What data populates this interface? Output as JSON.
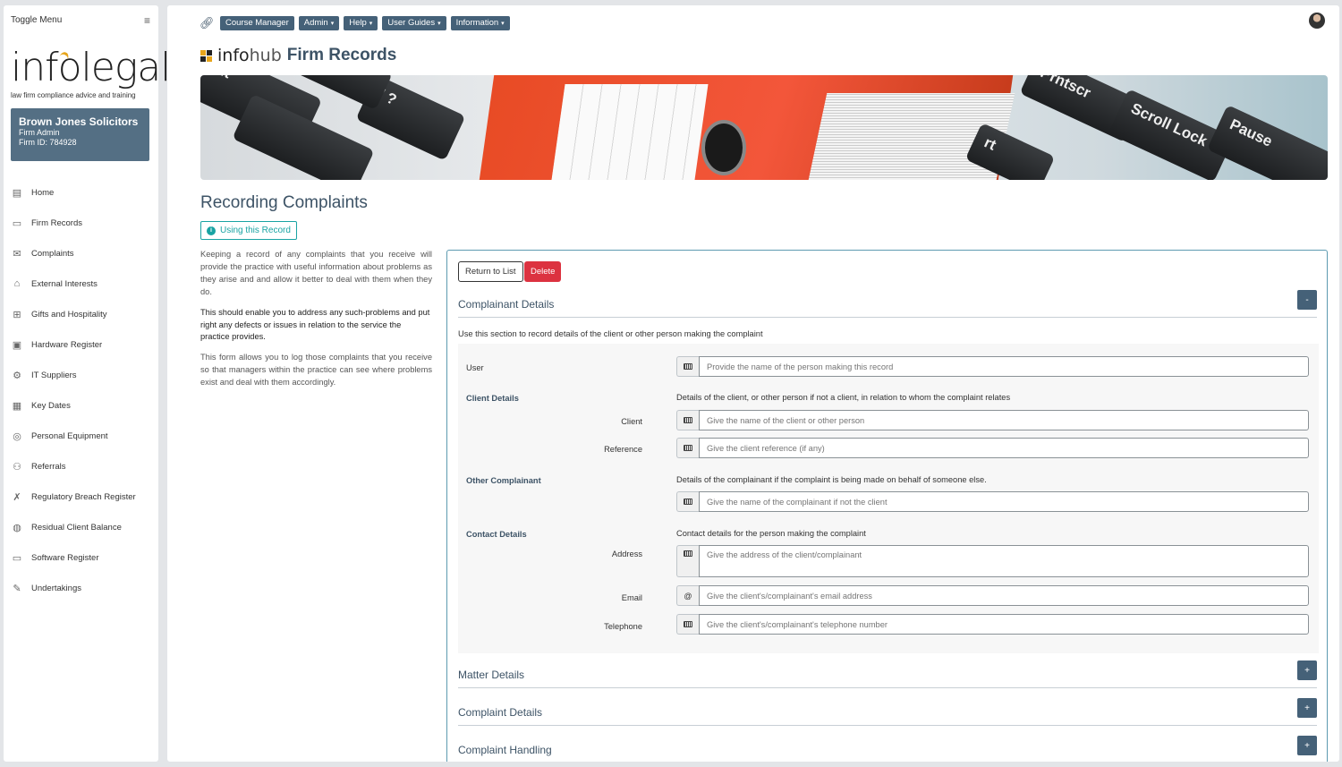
{
  "sidebar": {
    "toggle_label": "Toggle Menu",
    "hamburger_icon": "menu-icon",
    "logo_text": "infolegal",
    "logo_tagline": "law firm compliance advice and training",
    "firm": {
      "name": "Brown Jones Solicitors",
      "role": "Firm Admin",
      "id": "Firm ID: 784928"
    },
    "items": [
      {
        "label": "Home",
        "icon": "home-icon",
        "glyph": "▤"
      },
      {
        "label": "Firm Records",
        "icon": "records-icon",
        "glyph": "▭"
      },
      {
        "label": "Complaints",
        "icon": "complaints-icon",
        "glyph": "✉"
      },
      {
        "label": "External Interests",
        "icon": "external-interests-icon",
        "glyph": "⌂"
      },
      {
        "label": "Gifts and Hospitality",
        "icon": "gift-icon",
        "glyph": "⊞"
      },
      {
        "label": "Hardware Register",
        "icon": "hardware-icon",
        "glyph": "▣"
      },
      {
        "label": "IT Suppliers",
        "icon": "it-suppliers-icon",
        "glyph": "⚙"
      },
      {
        "label": "Key Dates",
        "icon": "calendar-icon",
        "glyph": "▦"
      },
      {
        "label": "Personal Equipment",
        "icon": "equipment-icon",
        "glyph": "◎"
      },
      {
        "label": "Referrals",
        "icon": "referrals-icon",
        "glyph": "⚇"
      },
      {
        "label": "Regulatory Breach Register",
        "icon": "breach-icon",
        "glyph": "✗"
      },
      {
        "label": "Residual Client Balance",
        "icon": "balance-icon",
        "glyph": "◍"
      },
      {
        "label": "Software Register",
        "icon": "software-icon",
        "glyph": "▭"
      },
      {
        "label": "Undertakings",
        "icon": "undertakings-icon",
        "glyph": "✎"
      }
    ]
  },
  "topnav": {
    "link_icon": "link-icon",
    "menus": [
      "Course Manager",
      "Admin",
      "Help",
      "User Guides",
      "Information"
    ],
    "menus_with_caret": [
      false,
      true,
      true,
      true,
      true
    ]
  },
  "app": {
    "brand_info": "info",
    "brand_hub": "hub",
    "title": "Firm Records"
  },
  "banner": {
    "keys": [
      "Alt",
      "Prntscr",
      "Scroll Lock",
      "Pause"
    ]
  },
  "page": {
    "heading": "Recording Complaints",
    "using_button": "Using this Record",
    "paragraphs": [
      "Keeping a record of any complaints that you receive will provide the practice with useful information about problems as they arise and and allow it better to deal with them when they do.",
      "This should enable you to address any such-problems and put right any defects or issues in relation to the service the practice provides.",
      "This form allows you to log those complaints that you receive so that managers within the practice can see where problems exist and deal with them accordingly."
    ]
  },
  "form": {
    "return_label": "Return to List",
    "delete_label": "Delete",
    "section1": {
      "title": "Complainant Details",
      "toggle": "-",
      "desc": "Use this section to record details of the client or other person making the complaint",
      "user_label": "User",
      "user_placeholder": "Provide the name of the person making this record",
      "client_heading": "Client Details",
      "client_note": "Details of the client, or other person if not a client, in relation to whom the complaint relates",
      "client_label": "Client",
      "client_placeholder": "Give the name of the client or other person",
      "reference_label": "Reference",
      "reference_placeholder": "Give the client reference (if any)",
      "other_heading": "Other Complainant",
      "other_note": "Details of the complainant if the complaint is being made on behalf of someone else.",
      "other_placeholder": "Give the name of the complainant if not the client",
      "contact_heading": "Contact Details",
      "contact_note": "Contact details for the person making the complaint",
      "address_label": "Address",
      "address_placeholder": "Give the address of the client/complainant",
      "email_label": "Email",
      "email_prefix": "@",
      "email_placeholder": "Give the client's/complainant's email address",
      "telephone_label": "Telephone",
      "telephone_placeholder": "Give the client's/complainant's telephone number"
    },
    "collapsed_sections": [
      {
        "title": "Matter Details",
        "toggle": "+"
      },
      {
        "title": "Complaint Details",
        "toggle": "+"
      },
      {
        "title": "Complaint Handling",
        "toggle": "+"
      }
    ]
  }
}
